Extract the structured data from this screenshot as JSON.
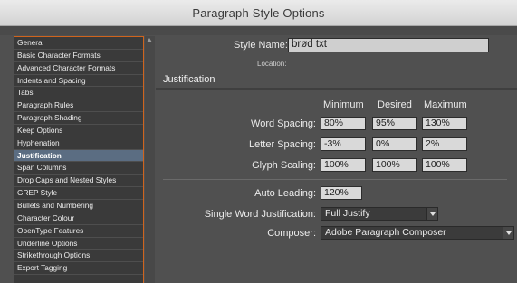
{
  "window": {
    "title": "Paragraph Style Options"
  },
  "categories": [
    "General",
    "Basic Character Formats",
    "Advanced Character Formats",
    "Indents and Spacing",
    "Tabs",
    "Paragraph Rules",
    "Paragraph Shading",
    "Keep Options",
    "Hyphenation",
    "Justification",
    "Span Columns",
    "Drop Caps and Nested Styles",
    "GREP Style",
    "Bullets and Numbering",
    "Character Colour",
    "OpenType Features",
    "Underline Options",
    "Strikethrough Options",
    "Export Tagging"
  ],
  "selected_category": "Justification",
  "style_name": {
    "label": "Style Name:",
    "value": "brød txt"
  },
  "location": {
    "label": "Location:"
  },
  "section": {
    "title": "Justification"
  },
  "columns": {
    "minimum": "Minimum",
    "desired": "Desired",
    "maximum": "Maximum"
  },
  "rows": {
    "word_spacing": {
      "label": "Word Spacing:",
      "min": "80%",
      "desired": "95%",
      "max": "130%"
    },
    "letter_spacing": {
      "label": "Letter Spacing:",
      "min": "-3%",
      "desired": "0%",
      "max": "2%"
    },
    "glyph_scaling": {
      "label": "Glyph Scaling:",
      "min": "100%",
      "desired": "100%",
      "max": "100%"
    }
  },
  "auto_leading": {
    "label": "Auto Leading:",
    "value": "120%"
  },
  "single_word": {
    "label": "Single Word Justification:",
    "value": "Full Justify"
  },
  "composer": {
    "label": "Composer:",
    "value": "Adobe Paragraph Composer"
  },
  "colors": {
    "accent_border": "#d0641d",
    "selection": "#5b6d82"
  }
}
